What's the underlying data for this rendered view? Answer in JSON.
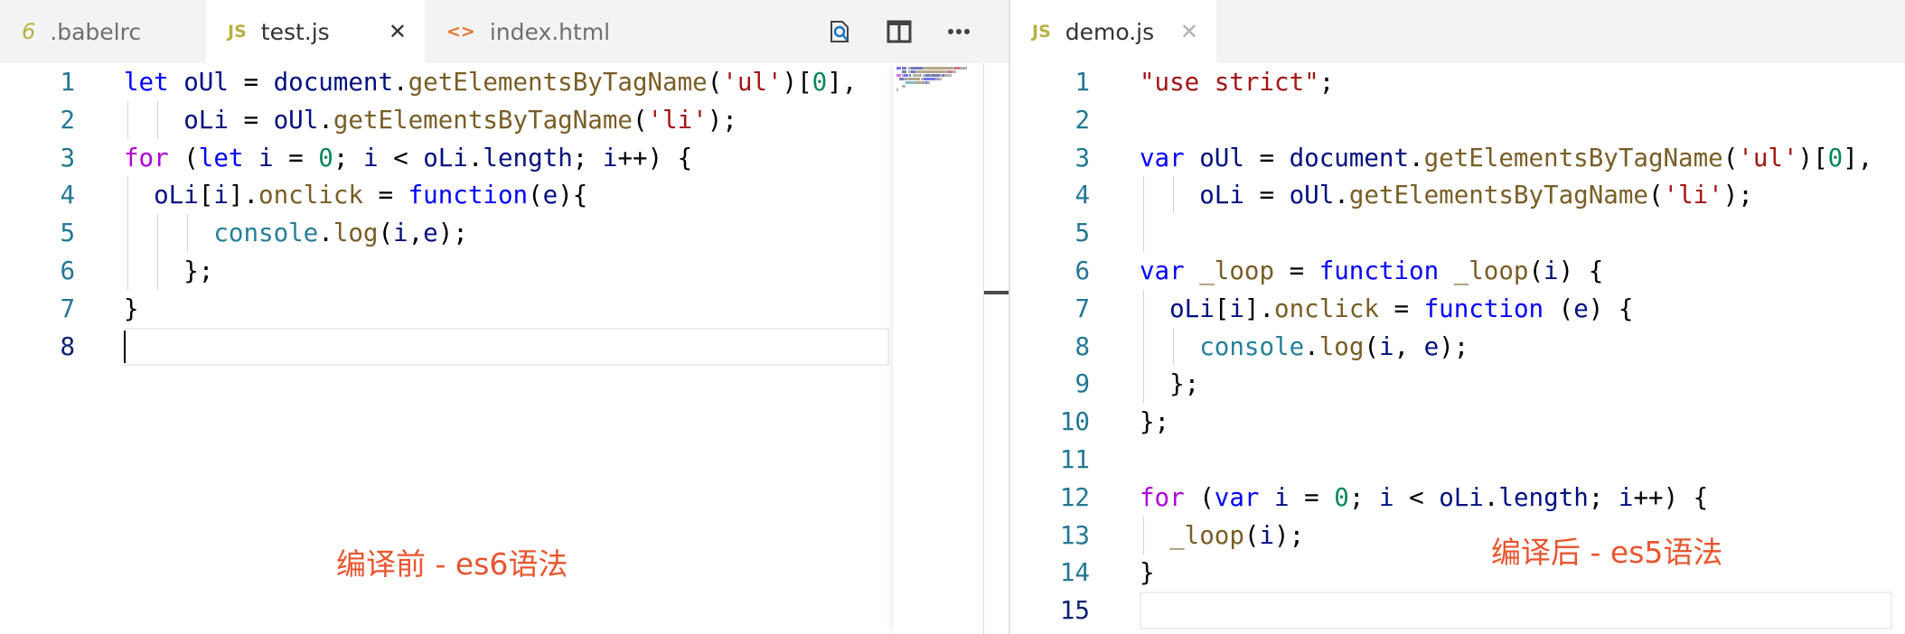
{
  "left": {
    "tabs": [
      {
        "icon": "6",
        "label": ".babelrc",
        "active": false
      },
      {
        "icon": "JS",
        "label": "test.js",
        "active": true,
        "close": "✕"
      },
      {
        "icon": "<>",
        "label": "index.html",
        "active": false
      }
    ],
    "actions": [
      "open-preview",
      "split-editor",
      "more"
    ],
    "lines": [
      [
        [
          "k",
          "let"
        ],
        [
          "v",
          " oUl"
        ],
        [
          "p",
          " = "
        ],
        [
          "v",
          "document"
        ],
        [
          "p",
          "."
        ],
        [
          "f",
          "getElementsByTagName"
        ],
        [
          "p",
          "("
        ],
        [
          "s",
          "'ul'"
        ],
        [
          "p",
          ")["
        ],
        [
          "n",
          "0"
        ],
        [
          "p",
          "],"
        ]
      ],
      [
        [
          "p",
          "    "
        ],
        [
          "v",
          "oLi"
        ],
        [
          "p",
          " = "
        ],
        [
          "v",
          "oUl"
        ],
        [
          "p",
          "."
        ],
        [
          "f",
          "getElementsByTagName"
        ],
        [
          "p",
          "("
        ],
        [
          "s",
          "'li'"
        ],
        [
          "p",
          ");"
        ]
      ],
      [
        [
          "kc",
          "for"
        ],
        [
          "p",
          " ("
        ],
        [
          "k",
          "let"
        ],
        [
          "v",
          " i"
        ],
        [
          "p",
          " = "
        ],
        [
          "n",
          "0"
        ],
        [
          "p",
          "; "
        ],
        [
          "v",
          "i"
        ],
        [
          "p",
          " < "
        ],
        [
          "v",
          "oLi"
        ],
        [
          "p",
          "."
        ],
        [
          "v",
          "length"
        ],
        [
          "p",
          "; "
        ],
        [
          "v",
          "i"
        ],
        [
          "p",
          "++) {"
        ]
      ],
      [
        [
          "p",
          "  "
        ],
        [
          "v",
          "oLi"
        ],
        [
          "p",
          "["
        ],
        [
          "v",
          "i"
        ],
        [
          "p",
          "]."
        ],
        [
          "f",
          "onclick"
        ],
        [
          "p",
          " = "
        ],
        [
          "k",
          "function"
        ],
        [
          "p",
          "("
        ],
        [
          "v",
          "e"
        ],
        [
          "p",
          "){"
        ]
      ],
      [
        [
          "p",
          "      "
        ],
        [
          "c",
          "console"
        ],
        [
          "p",
          "."
        ],
        [
          "f",
          "log"
        ],
        [
          "p",
          "("
        ],
        [
          "v",
          "i"
        ],
        [
          "p",
          ","
        ],
        [
          "v",
          "e"
        ],
        [
          "p",
          ");"
        ]
      ],
      [
        [
          "p",
          "    };"
        ]
      ],
      [
        [
          "p",
          "}"
        ]
      ],
      []
    ],
    "annotation": "编译前 - es6语法"
  },
  "right": {
    "tabs": [
      {
        "icon": "JS",
        "label": "demo.js",
        "active": true,
        "close": "✕"
      }
    ],
    "lines": [
      [
        [
          "s",
          "\"use strict\""
        ],
        [
          "p",
          ";"
        ]
      ],
      [],
      [
        [
          "k",
          "var"
        ],
        [
          "v",
          " oUl"
        ],
        [
          "p",
          " = "
        ],
        [
          "v",
          "document"
        ],
        [
          "p",
          "."
        ],
        [
          "f",
          "getElementsByTagName"
        ],
        [
          "p",
          "("
        ],
        [
          "s",
          "'ul'"
        ],
        [
          "p",
          ")["
        ],
        [
          "n",
          "0"
        ],
        [
          "p",
          "],"
        ]
      ],
      [
        [
          "p",
          "    "
        ],
        [
          "v",
          "oLi"
        ],
        [
          "p",
          " = "
        ],
        [
          "v",
          "oUl"
        ],
        [
          "p",
          "."
        ],
        [
          "f",
          "getElementsByTagName"
        ],
        [
          "p",
          "("
        ],
        [
          "s",
          "'li'"
        ],
        [
          "p",
          ");"
        ]
      ],
      [
        [
          "p",
          "  "
        ]
      ],
      [
        [
          "k",
          "var"
        ],
        [
          "f",
          " _loop"
        ],
        [
          "p",
          " = "
        ],
        [
          "k",
          "function"
        ],
        [
          "f",
          " _loop"
        ],
        [
          "p",
          "("
        ],
        [
          "v",
          "i"
        ],
        [
          "p",
          ") {"
        ]
      ],
      [
        [
          "p",
          "  "
        ],
        [
          "v",
          "oLi"
        ],
        [
          "p",
          "["
        ],
        [
          "v",
          "i"
        ],
        [
          "p",
          "]."
        ],
        [
          "f",
          "onclick"
        ],
        [
          "p",
          " = "
        ],
        [
          "k",
          "function"
        ],
        [
          "p",
          " ("
        ],
        [
          "v",
          "e"
        ],
        [
          "p",
          ") {"
        ]
      ],
      [
        [
          "p",
          "    "
        ],
        [
          "c",
          "console"
        ],
        [
          "p",
          "."
        ],
        [
          "f",
          "log"
        ],
        [
          "p",
          "("
        ],
        [
          "v",
          "i"
        ],
        [
          "p",
          ", "
        ],
        [
          "v",
          "e"
        ],
        [
          "p",
          ");"
        ]
      ],
      [
        [
          "p",
          "  };"
        ]
      ],
      [
        [
          "p",
          "};"
        ]
      ],
      [],
      [
        [
          "kc",
          "for"
        ],
        [
          "p",
          " ("
        ],
        [
          "k",
          "var"
        ],
        [
          "v",
          " i"
        ],
        [
          "p",
          " = "
        ],
        [
          "n",
          "0"
        ],
        [
          "p",
          "; "
        ],
        [
          "v",
          "i"
        ],
        [
          "p",
          " < "
        ],
        [
          "v",
          "oLi"
        ],
        [
          "p",
          "."
        ],
        [
          "v",
          "length"
        ],
        [
          "p",
          "; "
        ],
        [
          "v",
          "i"
        ],
        [
          "p",
          "++) {"
        ]
      ],
      [
        [
          "p",
          "  "
        ],
        [
          "f",
          "_loop"
        ],
        [
          "p",
          "("
        ],
        [
          "v",
          "i"
        ],
        [
          "p",
          ");"
        ]
      ],
      [
        [
          "p",
          "}"
        ]
      ],
      []
    ],
    "annotation": "编译后 - es5语法"
  },
  "colors": {
    "line_number": "#237893",
    "annotation": "#e8552f",
    "tab_bar": "#f3f3f3"
  }
}
